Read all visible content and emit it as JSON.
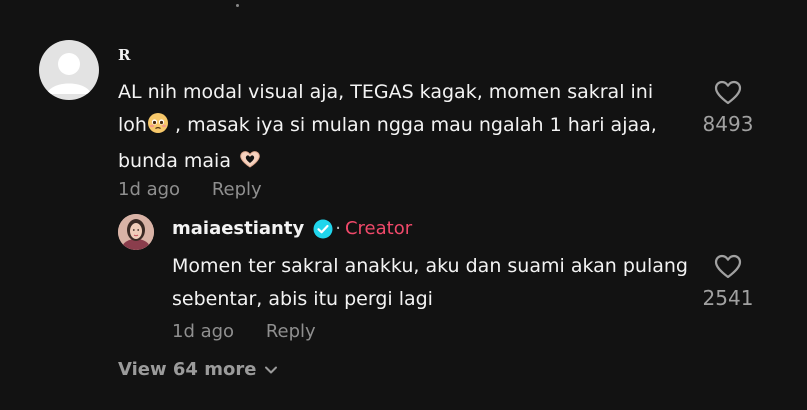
{
  "comment": {
    "username": "R",
    "text_part1": "AL nih modal visual aja, TEGAS kagak, momen sakral ini loh",
    "text_part2": " , masak iya si mulan ngga mau ngalah 1 hari ajaa, bunda maia ",
    "emoji1": "pleading-face-icon",
    "emoji2": "heart-hands-icon",
    "age": "1d ago",
    "reply_label": "Reply",
    "like_count": "8493"
  },
  "reply": {
    "username": "maiaestianty",
    "separator": "·",
    "badge": "Creator",
    "text": "Momen ter sakral anakku, aku dan suami akan pulang sebentar, abis itu pergi lagi",
    "age": "1d ago",
    "reply_label": "Reply",
    "like_count": "2541"
  },
  "view_more": {
    "label": "View 64 more"
  },
  "colors": {
    "background": "#121212",
    "creator_accent": "#f0496a",
    "verified": "#20d5ec"
  }
}
